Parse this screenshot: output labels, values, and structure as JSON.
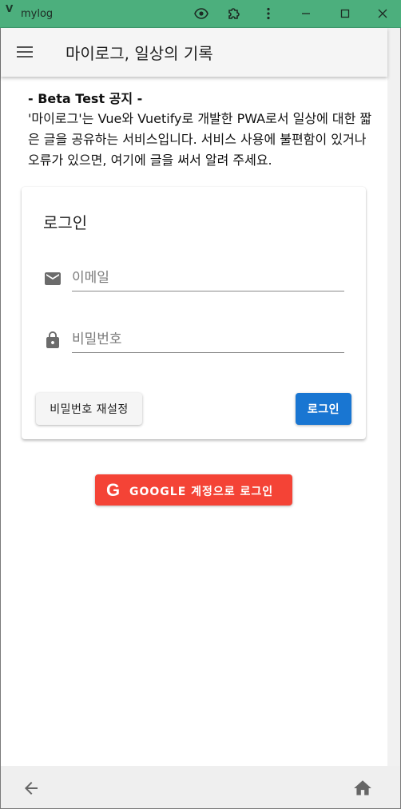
{
  "window": {
    "title": "mylog",
    "app_icon": "V",
    "controls": [
      "eye-icon",
      "puzzle-icon",
      "more-vert-icon",
      "minimize-icon",
      "maximize-icon",
      "close-icon"
    ],
    "bar_color": "#4caf7d"
  },
  "appbar": {
    "title": "마이로그, 일상의 기록",
    "menu_icon": "menu-icon"
  },
  "notice": {
    "title": "- Beta Test 공지 -",
    "body": "'마이로그'는 Vue와 Vuetify로 개발한 PWA로서 일상에 대한 짧은 글을 공유하는 서비스입니다. 서비스 사용에 불편함이 있거나 오류가 있으면, 여기에 글을 써서 알려 주세요."
  },
  "login_card": {
    "title": "로그인",
    "email": {
      "placeholder": "이메일",
      "value": "",
      "icon": "email-icon"
    },
    "password": {
      "placeholder": "비밀번호",
      "value": "",
      "icon": "lock-icon"
    },
    "reset_label": "비밀번호 재설정",
    "login_label": "로그인",
    "login_color": "#1976d2"
  },
  "google": {
    "icon_text": "G",
    "label": "GOOGLE 계정으로 로그인",
    "color": "#f44336"
  },
  "bottombar": {
    "back_icon": "back-arrow-icon",
    "home_icon": "home-icon"
  }
}
